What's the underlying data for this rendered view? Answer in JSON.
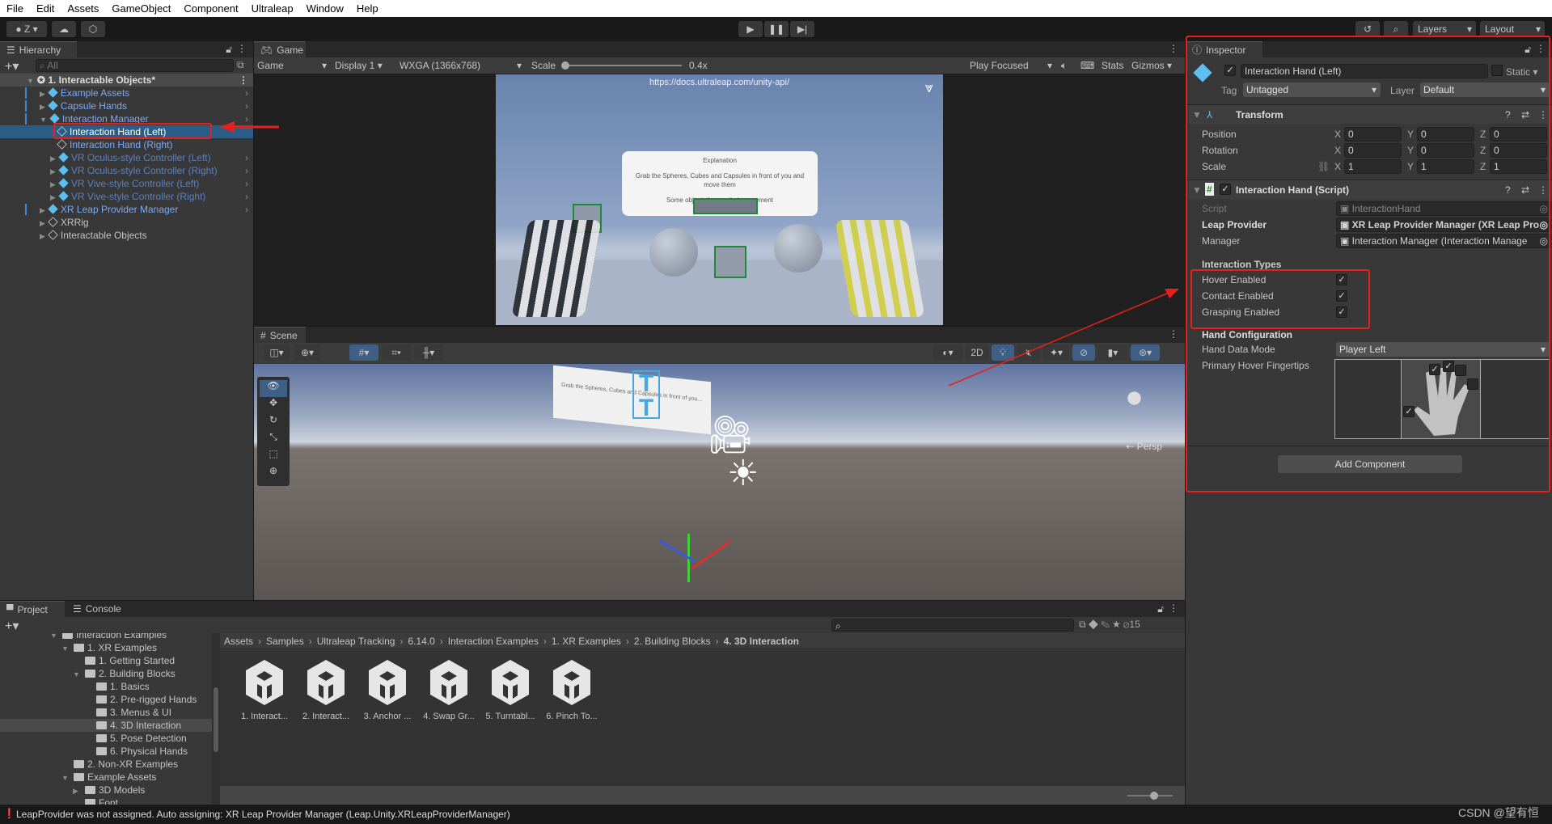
{
  "menu": [
    "File",
    "Edit",
    "Assets",
    "GameObject",
    "Component",
    "Ultraleap",
    "Window",
    "Help"
  ],
  "toolbar": {
    "account": "Z",
    "layers": "Layers",
    "layout": "Layout"
  },
  "hierarchy": {
    "tab": "Hierarchy",
    "search_placeholder": "All",
    "scene": "1. Interactable Objects*",
    "items": [
      {
        "label": "Example Assets",
        "style": "blue",
        "depth": 1,
        "arrow": "▶",
        "chev": true
      },
      {
        "label": "Capsule Hands",
        "style": "blue",
        "depth": 1,
        "arrow": "▶",
        "chev": true
      },
      {
        "label": "Interaction Manager",
        "style": "blue",
        "depth": 1,
        "arrow": "▼",
        "chev": true
      },
      {
        "label": "Interaction Hand (Left)",
        "style": "sel",
        "depth": 2,
        "arrow": "",
        "chev": false
      },
      {
        "label": "Interaction Hand (Right)",
        "style": "blue",
        "depth": 2,
        "arrow": "",
        "chev": false
      },
      {
        "label": "VR Oculus-style Controller (Left)",
        "style": "dim",
        "depth": 2,
        "arrow": "▶",
        "chev": true
      },
      {
        "label": "VR Oculus-style Controller (Right)",
        "style": "dim",
        "depth": 2,
        "arrow": "▶",
        "chev": true
      },
      {
        "label": "VR Vive-style Controller (Left)",
        "style": "dim",
        "depth": 2,
        "arrow": "▶",
        "chev": true
      },
      {
        "label": "VR Vive-style Controller (Right)",
        "style": "dim",
        "depth": 2,
        "arrow": "▶",
        "chev": true
      },
      {
        "label": "XR Leap Provider Manager",
        "style": "blue",
        "depth": 1,
        "arrow": "▶",
        "chev": true
      },
      {
        "label": "XRRig",
        "style": "plain",
        "depth": 1,
        "arrow": "▶",
        "chev": false
      },
      {
        "label": "Interactable Objects",
        "style": "plain",
        "depth": 1,
        "arrow": "▶",
        "chev": false
      }
    ]
  },
  "game": {
    "tab": "Game",
    "mode": "Game",
    "display": "Display 1",
    "resolution": "WXGA (1366x768)",
    "scale_label": "Scale",
    "scale_value": "0.4x",
    "play_mode": "Play Focused",
    "stats": "Stats",
    "gizmos": "Gizmos",
    "url": "https://docs.ultraleap.com/unity-api/",
    "panel_title": "Explanation",
    "panel_text1": "Grab the Spheres, Cubes and Capsules in front of you and move them",
    "panel_text2": "Some objects have... their movement"
  },
  "scene": {
    "tab": "Scene",
    "btn_2d": "2D",
    "persp": "Persp",
    "card_text": "Grab the Spheres, Cubes and Capsules in front of you..."
  },
  "inspector": {
    "tab": "Inspector",
    "object_name": "Interaction Hand (Left)",
    "static": "Static",
    "tag_label": "Tag",
    "tag": "Untagged",
    "layer_label": "Layer",
    "layer": "Default",
    "transform": {
      "title": "Transform",
      "rows": [
        {
          "label": "Position",
          "x": "0",
          "y": "0",
          "z": "0"
        },
        {
          "label": "Rotation",
          "x": "0",
          "y": "0",
          "z": "0"
        },
        {
          "label": "Scale",
          "x": "1",
          "y": "1",
          "z": "1"
        }
      ]
    },
    "script": {
      "title": "Interaction Hand (Script)",
      "script_label": "Script",
      "script_value": "InteractionHand",
      "provider_label": "Leap Provider",
      "provider_value": "XR Leap Provider Manager (XR Leap Pro",
      "manager_label": "Manager",
      "manager_value": "Interaction Manager (Interaction Manage",
      "types_header": "Interaction Types",
      "types": [
        {
          "label": "Hover Enabled",
          "checked": true
        },
        {
          "label": "Contact Enabled",
          "checked": true
        },
        {
          "label": "Grasping Enabled",
          "checked": true
        }
      ],
      "config_header": "Hand Configuration",
      "mode_label": "Hand Data Mode",
      "mode_value": "Player Left",
      "fingertips_label": "Primary Hover Fingertips",
      "fingertips": {
        "thumb": true,
        "index": true,
        "middle": true,
        "ring": false,
        "pinky": false
      }
    },
    "add_component": "Add Component"
  },
  "project": {
    "tab_project": "Project",
    "tab_console": "Console",
    "hidden_count": "15",
    "tree": [
      {
        "label": "Interaction Examples",
        "depth": 0,
        "arrow": "▼",
        "open": true
      },
      {
        "label": "1. XR Examples",
        "depth": 1,
        "arrow": "▼",
        "open": true
      },
      {
        "label": "1. Getting Started",
        "depth": 2,
        "arrow": "",
        "open": false
      },
      {
        "label": "2. Building Blocks",
        "depth": 2,
        "arrow": "▼",
        "open": true
      },
      {
        "label": "1. Basics",
        "depth": 3,
        "arrow": "",
        "open": false
      },
      {
        "label": "2. Pre-rigged Hands",
        "depth": 3,
        "arrow": "",
        "open": false
      },
      {
        "label": "3. Menus & UI",
        "depth": 3,
        "arrow": "",
        "open": false
      },
      {
        "label": "4. 3D Interaction",
        "depth": 3,
        "arrow": "",
        "open": false,
        "selected": true
      },
      {
        "label": "5. Pose Detection",
        "depth": 3,
        "arrow": "",
        "open": false
      },
      {
        "label": "6. Physical Hands",
        "depth": 3,
        "arrow": "",
        "open": false
      },
      {
        "label": "2. Non-XR Examples",
        "depth": 1,
        "arrow": "",
        "open": false
      },
      {
        "label": "Example Assets",
        "depth": 1,
        "arrow": "▼",
        "open": true
      },
      {
        "label": "3D Models",
        "depth": 2,
        "arrow": "▶",
        "open": false
      },
      {
        "label": "Font",
        "depth": 2,
        "arrow": "",
        "open": false
      }
    ],
    "breadcrumb": [
      "Assets",
      "Samples",
      "Ultraleap Tracking",
      "6.14.0",
      "Interaction Examples",
      "1. XR Examples",
      "2. Building Blocks",
      "4. 3D Interaction"
    ],
    "assets": [
      "1. Interact...",
      "2. Interact...",
      "3. Anchor ...",
      "4. Swap Gr...",
      "5. Turntabl...",
      "6. Pinch To..."
    ]
  },
  "status": {
    "message": "LeapProvider was not assigned. Auto assigning: XR Leap Provider Manager (Leap.Unity.XRLeapProviderManager)",
    "watermark": "CSDN @望有恒"
  },
  "colors": {
    "accent": "#2c5d87",
    "annotation": "#e8201b",
    "panel": "#383838"
  }
}
